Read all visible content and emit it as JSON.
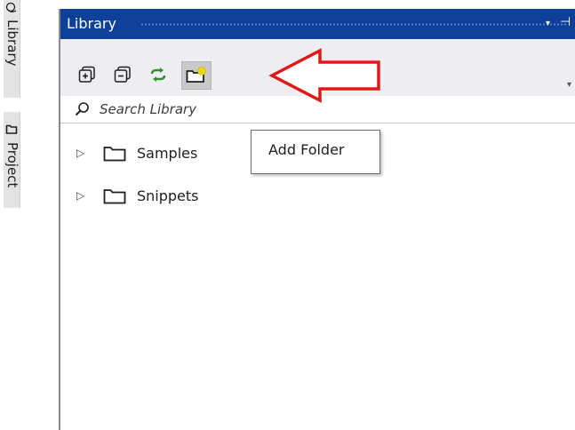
{
  "side_tabs": [
    {
      "label": "Library",
      "icon": "library-icon"
    },
    {
      "label": "Project",
      "icon": "project-icon"
    }
  ],
  "panel": {
    "title": "Library",
    "title_buttons": {
      "dropdown": "▾",
      "pin": "⊣"
    }
  },
  "toolbar": {
    "buttons": [
      {
        "name": "expand-all",
        "icon": "expand-all-icon"
      },
      {
        "name": "collapse-all",
        "icon": "collapse-all-icon"
      },
      {
        "name": "refresh",
        "icon": "refresh-icon"
      },
      {
        "name": "add-folder",
        "icon": "add-folder-icon",
        "state": "hovered"
      }
    ],
    "overflow": "▾"
  },
  "search": {
    "placeholder": "Search Library",
    "value": ""
  },
  "tree": [
    {
      "label": "Samples",
      "expanded": false
    },
    {
      "label": "Snippets",
      "expanded": false
    }
  ],
  "tooltip": {
    "text": "Add Folder"
  },
  "colors": {
    "title_bar": "#0e3f99",
    "toolbar_bg": "#eeeef2",
    "refresh_green": "#2f8f2f",
    "folder_yellow": "#f2d50f",
    "annotation_red": "#e01818"
  }
}
